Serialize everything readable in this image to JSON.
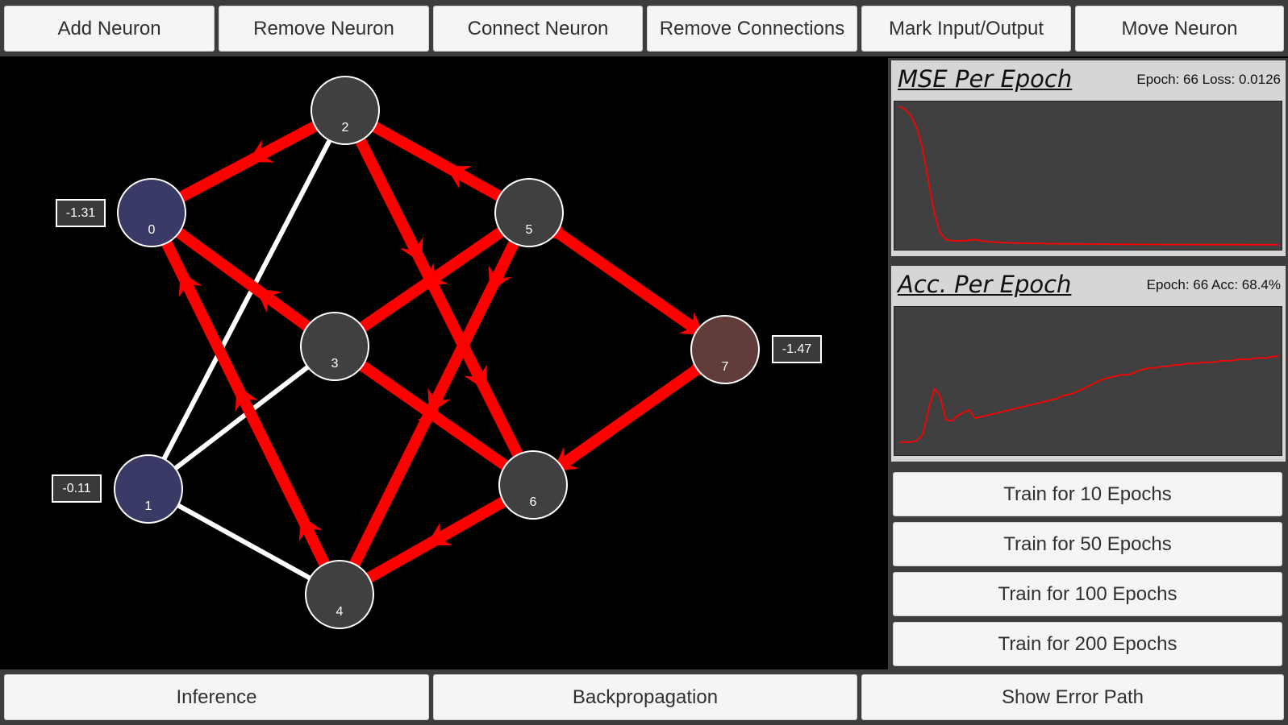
{
  "toolbar": {
    "add_neuron": "Add Neuron",
    "remove_neuron": "Remove Neuron",
    "connect_neuron": "Connect Neuron",
    "remove_connections": "Remove Connections",
    "mark_io": "Mark Input/Output",
    "move_neuron": "Move Neuron"
  },
  "network": {
    "neurons": [
      {
        "id": "0",
        "role": "input"
      },
      {
        "id": "1",
        "role": "input"
      },
      {
        "id": "2",
        "role": "hidden"
      },
      {
        "id": "3",
        "role": "hidden"
      },
      {
        "id": "4",
        "role": "hidden"
      },
      {
        "id": "5",
        "role": "hidden"
      },
      {
        "id": "6",
        "role": "hidden"
      },
      {
        "id": "7",
        "role": "output"
      }
    ],
    "values": {
      "n0": "-1.31",
      "n1": "-0.11",
      "n7": "-1.47"
    },
    "colors": {
      "input": "#3a3a66",
      "hidden": "#404040",
      "output": "#623b3b",
      "error_edge": "#ff0000",
      "edge": "#ffffff"
    }
  },
  "mse_panel": {
    "title": "MSE Per Epoch",
    "stat": "Epoch: 66 Loss: 0.0126"
  },
  "acc_panel": {
    "title": "Acc. Per Epoch",
    "stat": "Epoch: 66 Acc: 68.4%"
  },
  "training": {
    "train_10": "Train for 10 Epochs",
    "train_50": "Train for 50 Epochs",
    "train_100": "Train for 100 Epochs",
    "train_200": "Train for 200 Epochs"
  },
  "bottom": {
    "inference": "Inference",
    "backpropagation": "Backpropagation",
    "show_error_path": "Show Error Path"
  },
  "chart_data": [
    {
      "type": "line",
      "title": "MSE Per Epoch",
      "series": [
        {
          "values": [
            1.0,
            0.98,
            0.93,
            0.85,
            0.7,
            0.47,
            0.24,
            0.1,
            0.05,
            0.04,
            0.04,
            0.04,
            0.045,
            0.05,
            0.04,
            0.035,
            0.032,
            0.03,
            0.028,
            0.026,
            0.025,
            0.024,
            0.023,
            0.022,
            0.021,
            0.021,
            0.02,
            0.02,
            0.019,
            0.019,
            0.018,
            0.018,
            0.018,
            0.017,
            0.017,
            0.017,
            0.016,
            0.016,
            0.016,
            0.016,
            0.015,
            0.015,
            0.015,
            0.015,
            0.015,
            0.014,
            0.014,
            0.014,
            0.014,
            0.014,
            0.014,
            0.013,
            0.013,
            0.013,
            0.013,
            0.013,
            0.013,
            0.013,
            0.013,
            0.013,
            0.0128,
            0.0128,
            0.0127,
            0.0127,
            0.0126,
            0.0126
          ]
        }
      ],
      "color": "#ff0000"
    },
    {
      "type": "line",
      "title": "Acc. Per Epoch",
      "series": [
        {
          "values": [
            7,
            7,
            7,
            8,
            12,
            30,
            45,
            40,
            23,
            22,
            26,
            28,
            30,
            24,
            25,
            26,
            27,
            28,
            29,
            30,
            31,
            32,
            33,
            34,
            35,
            36,
            37,
            38,
            40,
            41,
            42,
            44,
            46,
            48,
            50,
            52,
            53,
            54,
            55,
            55,
            56,
            58,
            59,
            60,
            60,
            61,
            61,
            62,
            62,
            63,
            63,
            63,
            64,
            64,
            64,
            65,
            65,
            65,
            66,
            66,
            66,
            67,
            67,
            67,
            68,
            68.4
          ]
        }
      ],
      "color": "#ff0000"
    }
  ]
}
